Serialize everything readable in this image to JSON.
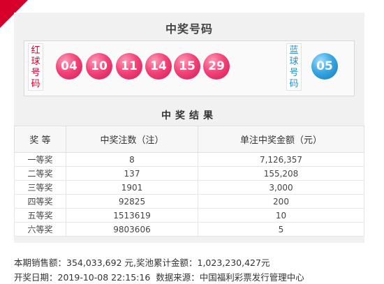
{
  "header": {
    "title": "中奖号码"
  },
  "balls": {
    "red_label": [
      "红",
      "球",
      "号",
      "码"
    ],
    "red": [
      "04",
      "10",
      "11",
      "14",
      "15",
      "29"
    ],
    "blue_label": [
      "蓝",
      "球",
      "号",
      "码"
    ],
    "blue": [
      "05"
    ]
  },
  "results": {
    "title": "中奖结果",
    "columns": [
      "奖 等",
      "中奖注数（注）",
      "单注中奖金额（元）"
    ],
    "rows": [
      {
        "level": "一等奖",
        "count": "8",
        "amount": "7,126,357"
      },
      {
        "level": "二等奖",
        "count": "137",
        "amount": "155,208"
      },
      {
        "level": "三等奖",
        "count": "1901",
        "amount": "3,000"
      },
      {
        "level": "四等奖",
        "count": "92825",
        "amount": "200"
      },
      {
        "level": "五等奖",
        "count": "1513619",
        "amount": "10"
      },
      {
        "level": "六等奖",
        "count": "9803606",
        "amount": "5"
      }
    ]
  },
  "footer": {
    "sales_label": "本期销售额：",
    "sales_value": "354,033,692 元",
    "pool_label": ",奖池累计金额：",
    "pool_value": "1,023,230,427元",
    "date_label": "开奖日期：",
    "date_value": "2019-10-08 22:15:16",
    "source_label": "数据来源：",
    "source_value": "中国福利彩票发行管理中心"
  }
}
